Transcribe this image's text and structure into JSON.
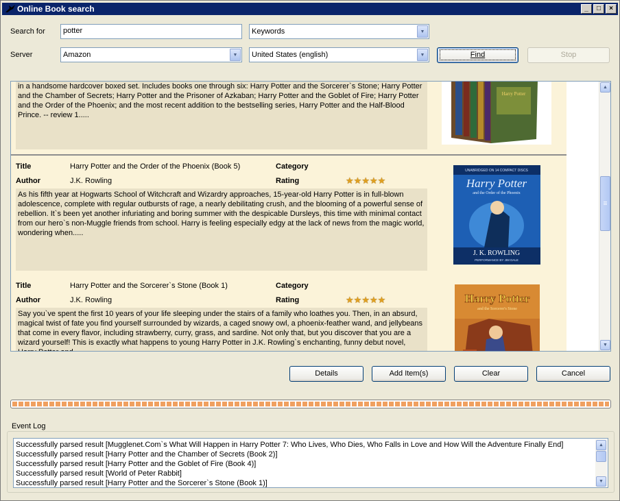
{
  "window": {
    "title": "Online Book search",
    "controls": {
      "minimize": "_",
      "maximize": "□",
      "close": "×"
    }
  },
  "search": {
    "search_for_label": "Search for",
    "query": "potter",
    "field": "Keywords",
    "server_label": "Server",
    "server": "Amazon",
    "locale": "United States (english)",
    "find_label": "Find",
    "stop_label": "Stop"
  },
  "results": {
    "partial_top": {
      "description": "in a handsome hardcover boxed set. Includes books one through six: Harry Potter and the Sorcerer`s Stone; Harry Potter and the Chamber of Secrets; Harry Potter and the Prisoner of Azkaban; Harry Potter and the Goblet of Fire; Harry Potter and the Order of the Phoenix; and the most recent addition to the bestselling series, Harry Potter and the Half-Blood Prince. -- review 1....."
    },
    "field_labels": {
      "title": "Title",
      "author": "Author",
      "category": "Category",
      "rating": "Rating"
    },
    "items": [
      {
        "title": "Harry Potter and the Order of the Phoenix (Book 5)",
        "author": "J.K. Rowling",
        "category": "",
        "rating": 5,
        "description": "As his fifth year at Hogwarts School of Witchcraft and Wizardry approaches, 15-year-old Harry Potter is in full-blown adolescence, complete with regular outbursts of rage, a nearly debilitating crush, and the blooming of a powerful sense of rebellion. It`s been yet another infuriating and boring summer with the despicable Dursleys, this time with minimal contact from our hero`s non-Muggle friends from school. Harry is feeling especially edgy at the lack of news from the magic world, wondering when.....",
        "cover": {
          "top_text": "UNABRIDGED ON 14 COMPACT DISCS",
          "brand": "Harry Potter",
          "sub": "and the Order of the Phoenix",
          "author_text": "J. K. ROWLING",
          "bottom_text": "PERFORMANCE BY JIM DALE",
          "bg": "#1d5fb4"
        }
      },
      {
        "title": "Harry Potter and the Sorcerer`s Stone (Book 1)",
        "author": "J.K. Rowling",
        "category": "",
        "rating": 5,
        "description": "Say you`ve spent the first 10 years of your life sleeping under the stairs of a family who loathes you. Then, in an absurd, magical twist of fate you find yourself surrounded by wizards, a caged snowy owl, a phoenix-feather wand, and jellybeans that come in every flavor, including strawberry, curry, grass, and sardine. Not only that, but you discover that you are a wizard yourself! This is exactly what happens to young Harry Potter in J.K. Rowling`s enchanting, funny debut novel, Harry Potter and...",
        "cover": {
          "brand": "Harry Potter",
          "sub": "and the Sorcerer's Stone",
          "bg": "#c9762a"
        }
      }
    ]
  },
  "actions": {
    "details": "Details",
    "add_items": "Add Item(s)",
    "clear": "Clear",
    "cancel": "Cancel"
  },
  "progress": {
    "value": 1.0,
    "color": "#f0a060"
  },
  "event_log": {
    "title": "Event Log",
    "lines": [
      "Successfully parsed result [Mugglenet.Com`s What Will Happen in Harry Potter 7: Who Lives, Who Dies, Who Falls in Love and How Will the Adventure Finally End]",
      "Successfully parsed result [Harry Potter and the Chamber of Secrets (Book 2)]",
      "Successfully parsed result [Harry Potter and the Goblet of Fire (Book 4)]",
      "Successfully parsed result [World of Peter Rabbit]",
      "Successfully parsed result [Harry Potter and the Sorcerer`s Stone (Book 1)]"
    ]
  }
}
